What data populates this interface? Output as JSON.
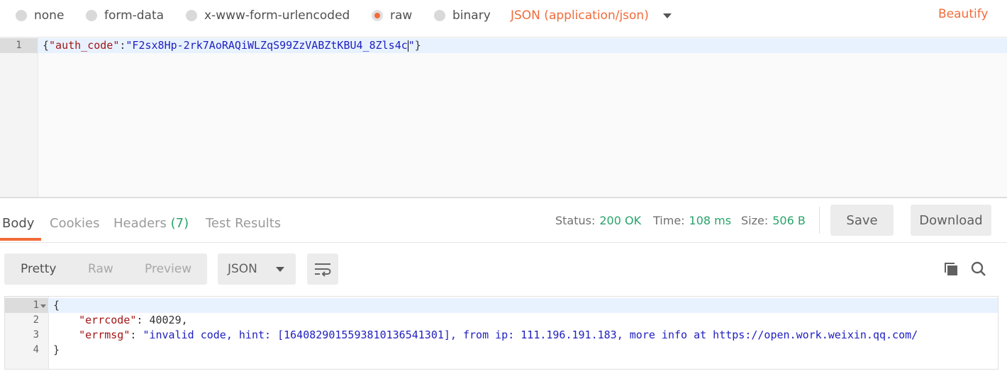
{
  "body_types": [
    {
      "label": "none",
      "selected": false
    },
    {
      "label": "form-data",
      "selected": false
    },
    {
      "label": "x-www-form-urlencoded",
      "selected": false
    },
    {
      "label": "raw",
      "selected": true
    },
    {
      "label": "binary",
      "selected": false
    }
  ],
  "content_type": "JSON (application/json)",
  "beautify_label": "Beautify",
  "request_editor": {
    "line_number": "1",
    "open": "{",
    "key": "\"auth_code\"",
    "colon": ":",
    "value": "\"F2sx8Hp-2rk7AoRAQiWLZqS99ZzVABZtKBU4_8Zls4c",
    "value_end": "\"",
    "close": "}"
  },
  "response_tabs": {
    "body": "Body",
    "cookies": "Cookies",
    "headers": "Headers",
    "headers_count": "(7)",
    "tests": "Test Results"
  },
  "status": {
    "status_label": "Status:",
    "status_value": "200 OK",
    "time_label": "Time:",
    "time_value": "108 ms",
    "size_label": "Size:",
    "size_value": "506 B"
  },
  "actions": {
    "save": "Save",
    "download": "Download"
  },
  "view_modes": {
    "pretty": "Pretty",
    "raw": "Raw",
    "preview": "Preview",
    "selected": "Pretty"
  },
  "format_select": "JSON",
  "icons": {
    "wrap": "wrap-lines-icon",
    "copy": "copy-icon",
    "search": "search-icon"
  },
  "colors": {
    "accent": "#f26b3a",
    "success": "#29a36a",
    "string": "#2020c0",
    "key": "#a31515"
  },
  "response": {
    "line_numbers": [
      "1",
      "2",
      "3",
      "4"
    ],
    "l1": "{",
    "errcode_key": "\"errcode\"",
    "errcode_value": "40029",
    "errmsg_key": "\"errmsg\"",
    "errmsg_value": "\"invalid code, hint: [1640829015593810136541301], from ip: 111.196.191.183, more info at https://open.work.weixin.qq.com/",
    "l4": "}"
  }
}
